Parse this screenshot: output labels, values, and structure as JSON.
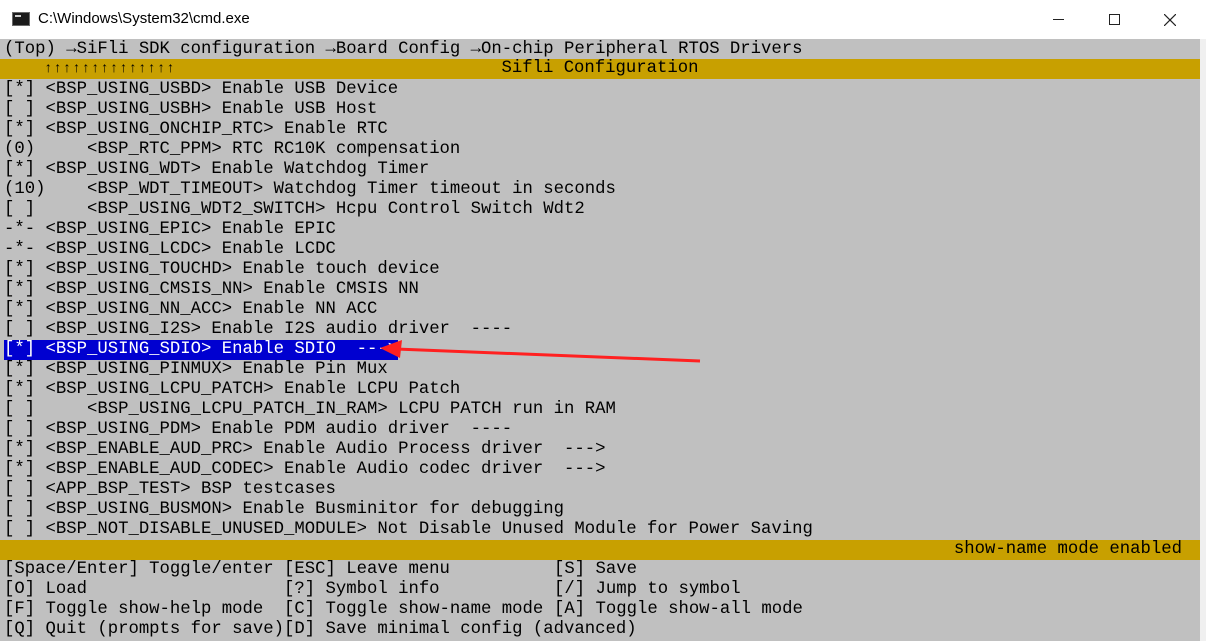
{
  "window": {
    "title": "C:\\Windows\\System32\\cmd.exe",
    "min_label": "—",
    "max_label": "□",
    "close_label": "✕"
  },
  "breadcrumb": "(Top) →SiFli SDK configuration →Board Config →On-chip Peripheral RTOS Drivers",
  "header": {
    "arrows": "↑↑↑↑↑↑↑↑↑↑↑↑↑↑",
    "title": "Sifli Configuration"
  },
  "items": [
    "[*] <BSP_USING_USBD> Enable USB Device",
    "[ ] <BSP_USING_USBH> Enable USB Host",
    "[*] <BSP_USING_ONCHIP_RTC> Enable RTC",
    "(0)     <BSP_RTC_PPM> RTC RC10K compensation",
    "[*] <BSP_USING_WDT> Enable Watchdog Timer",
    "(10)    <BSP_WDT_TIMEOUT> Watchdog Timer timeout in seconds",
    "[ ]     <BSP_USING_WDT2_SWITCH> Hcpu Control Switch Wdt2",
    "-*- <BSP_USING_EPIC> Enable EPIC",
    "-*- <BSP_USING_LCDC> Enable LCDC",
    "[*] <BSP_USING_TOUCHD> Enable touch device",
    "[*] <BSP_USING_CMSIS_NN> Enable CMSIS NN",
    "[*] <BSP_USING_NN_ACC> Enable NN ACC",
    "[ ] <BSP_USING_I2S> Enable I2S audio driver  ----",
    "[*] <BSP_USING_SDIO> Enable SDIO  --->",
    "[*] <BSP_USING_PINMUX> Enable Pin Mux",
    "[*] <BSP_USING_LCPU_PATCH> Enable LCPU Patch",
    "[ ]     <BSP_USING_LCPU_PATCH_IN_RAM> LCPU PATCH run in RAM",
    "[ ] <BSP_USING_PDM> Enable PDM audio driver  ----",
    "[*] <BSP_ENABLE_AUD_PRC> Enable Audio Process driver  --->",
    "[*] <BSP_ENABLE_AUD_CODEC> Enable Audio codec driver  --->",
    "[ ] <APP_BSP_TEST> BSP testcases",
    "[ ] <BSP_USING_BUSMON> Enable Busminitor for debugging",
    "[ ] <BSP_NOT_DISABLE_UNUSED_MODULE> Not Disable Unused Module for Power Saving"
  ],
  "selected_index": 13,
  "status": "show-name mode enabled",
  "help": [
    [
      "[Space/Enter] Toggle/enter",
      "[ESC] Leave menu",
      "[S] Save"
    ],
    [
      "[O] Load",
      "[?] Symbol info",
      "[/] Jump to symbol"
    ],
    [
      "[F] Toggle show-help mode",
      "[C] Toggle show-name mode",
      "[A] Toggle show-all mode"
    ],
    [
      "[Q] Quit (prompts for save)",
      "[D] Save minimal config (advanced)",
      ""
    ]
  ],
  "colors": {
    "console_bg": "#c0c0c0",
    "bar_bg": "#c8a000",
    "selection_bg": "#0000d0",
    "annotation_arrow": "#ff2020"
  }
}
